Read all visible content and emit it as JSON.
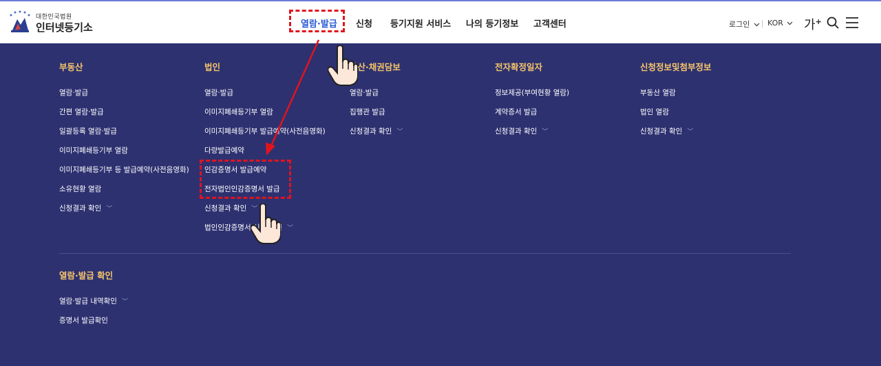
{
  "header": {
    "logo_sub": "대한민국법원",
    "logo_main": "인터넷등기소",
    "nav": [
      {
        "label": "열람·발급",
        "active": true
      },
      {
        "label": "신청",
        "active": false
      },
      {
        "label": "등기지원 서비스",
        "active": false
      },
      {
        "label": "나의 등기정보",
        "active": false
      },
      {
        "label": "고객센터",
        "active": false
      }
    ],
    "login_label": "로그인",
    "lang_label": "KOR",
    "font_label": "가",
    "font_plus": "+"
  },
  "menu": {
    "columns": [
      {
        "title": "부동산",
        "items": [
          {
            "label": "열람·발급"
          },
          {
            "label": "간편 열람·발급"
          },
          {
            "label": "일괄등록 열람·발급"
          },
          {
            "label": "이미지폐쇄등기부 열람"
          },
          {
            "label": "이미지폐쇄등기부 등 발급예약(사전음영화)"
          },
          {
            "label": "소유현황 열람"
          },
          {
            "label": "신청결과 확인"
          }
        ]
      },
      {
        "title": "법인",
        "items": [
          {
            "label": "열람·발급"
          },
          {
            "label": "이미지폐쇄등기부 열람"
          },
          {
            "label": "이미지폐쇄등기부 발급예약(사전음영화)"
          },
          {
            "label": "다량발급예약"
          },
          {
            "label": "인감증명서 발급예약"
          },
          {
            "label": "전자법인인감증명서 발급"
          },
          {
            "label": "신청결과 확인"
          },
          {
            "label": "법인인감증명서 신청 확인"
          }
        ]
      },
      {
        "title": "동산·채권담보",
        "items": [
          {
            "label": "열람·발급"
          },
          {
            "label": "집행관 발급"
          },
          {
            "label": "신청결과 확인"
          }
        ]
      },
      {
        "title": "전자확정일자",
        "items": [
          {
            "label": "정보제공(부여현황 열람)"
          },
          {
            "label": "계약증서 발급"
          },
          {
            "label": "신청결과 확인"
          }
        ]
      },
      {
        "title": "신청정보및첨부정보",
        "items": [
          {
            "label": "부동산 열람"
          },
          {
            "label": "법인 열람"
          },
          {
            "label": "신청결과 확인"
          }
        ]
      }
    ],
    "bottom": {
      "title": "열람·발급 확인",
      "items": [
        {
          "label": "열람·발급 내역확인"
        },
        {
          "label": "증명서 발급확인"
        }
      ]
    }
  },
  "colors": {
    "menu_bg": "#2d3170",
    "title_color": "#f5c46a",
    "active_nav": "#2a5bd7",
    "annotation_red": "#e0141e"
  }
}
